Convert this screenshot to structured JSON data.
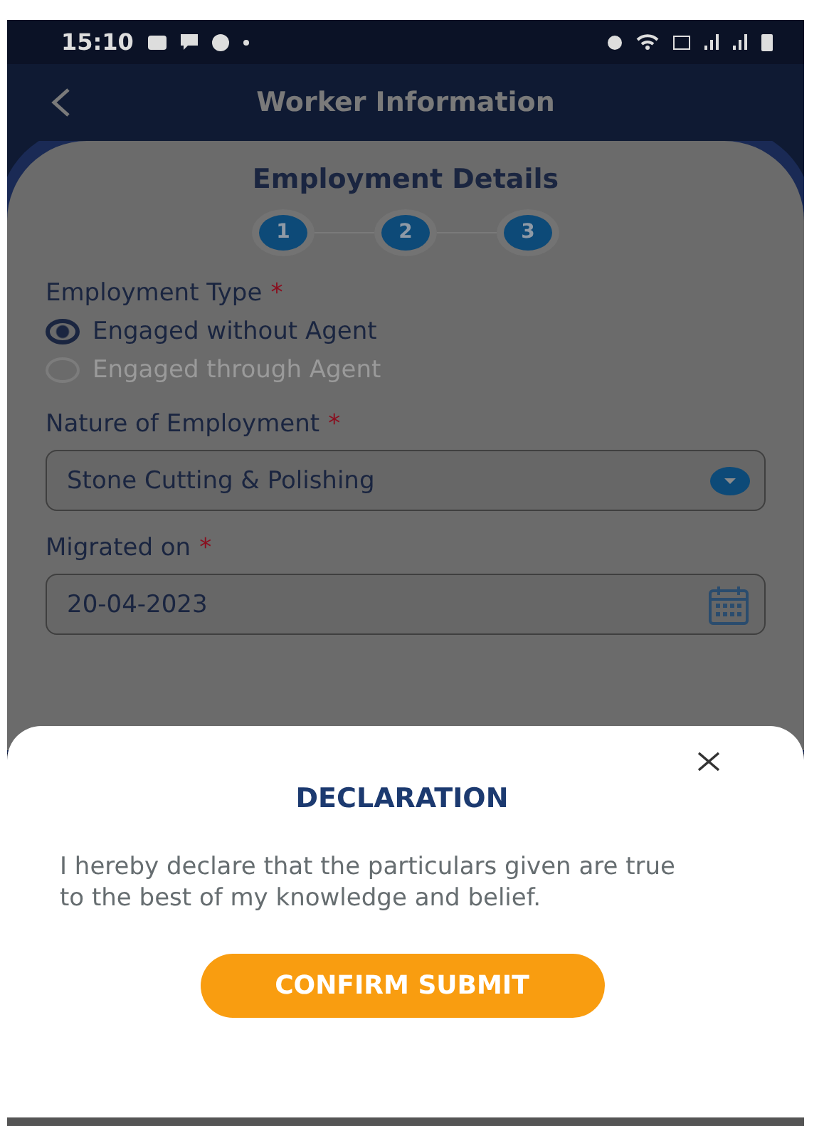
{
  "status_bar": {
    "time": "15:10"
  },
  "header": {
    "title": "Worker Information"
  },
  "card": {
    "title": "Employment Details",
    "steps": [
      {
        "label": "1"
      },
      {
        "label": "2"
      },
      {
        "label": "3"
      }
    ],
    "employment_type": {
      "label": "Employment Type",
      "required_mark": "*",
      "options": [
        {
          "label": "Engaged without Agent",
          "selected": true
        },
        {
          "label": "Engaged through Agent",
          "selected": false
        }
      ]
    },
    "nature_of_employment": {
      "label": "Nature of Employment",
      "required_mark": "*",
      "value": "Stone Cutting & Polishing"
    },
    "migrated_on": {
      "label": "Migrated on",
      "required_mark": "*",
      "value": "20-04-2023"
    }
  },
  "dialog": {
    "title": "DECLARATION",
    "body": "I hereby declare that the particulars given are true to the best of my knowledge and belief.",
    "button": "CONFIRM SUBMIT"
  }
}
